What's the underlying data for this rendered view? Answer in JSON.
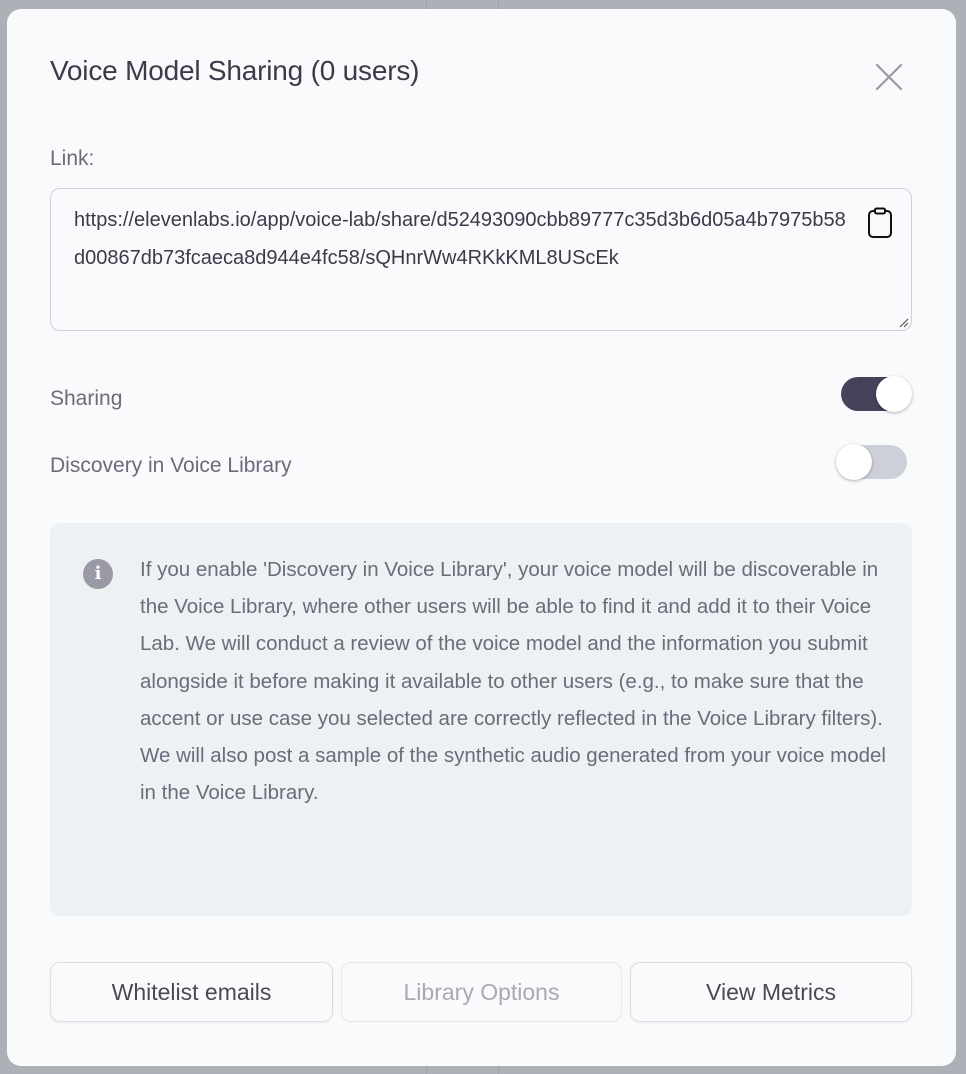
{
  "modal": {
    "title": "Voice Model Sharing (0 users)",
    "link_label": "Link:",
    "link_value": "https://elevenlabs.io/app/voice-lab/share/d52493090cbb89777c35d3b6d05a4b7975b58d00867db73fcaeca8d944e4fc58/sQHnrWw4RKkKML8UScEk",
    "sharing_label": "Sharing",
    "sharing_on": true,
    "discovery_label": "Discovery in Voice Library",
    "discovery_on": false,
    "info_text": "If you enable 'Discovery in Voice Library', your voice model will be discoverable in the Voice Library, where other users will be able to find it and add it to their Voice Lab. We will conduct a review of the voice model and the information you submit alongside it before making it available to other users (e.g., to make sure that the accent or use case you selected are correctly reflected in the Voice Library filters). We will also post a sample of the synthetic audio generated from your voice model in the Voice Library.",
    "buttons": {
      "whitelist": "Whitelist emails",
      "library": "Library Options",
      "metrics": "View Metrics"
    }
  },
  "colors": {
    "toggle_on": "#45435a",
    "toggle_off": "#cdd0d8"
  }
}
